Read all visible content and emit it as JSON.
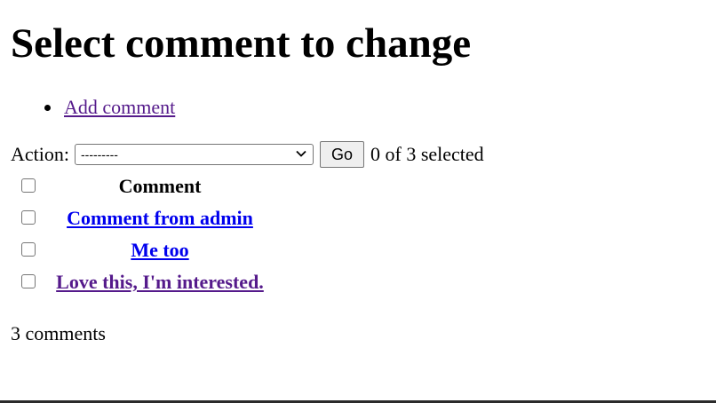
{
  "page": {
    "title": "Select comment to change"
  },
  "object_tools": {
    "add_label": "Add comment"
  },
  "actions": {
    "label": "Action:",
    "selected_option": "---------",
    "go_label": "Go",
    "selection_counter": "0 of 3 selected"
  },
  "table": {
    "header": "Comment",
    "rows": [
      {
        "label": "Comment from admin",
        "visited": false
      },
      {
        "label": "Me too",
        "visited": false
      },
      {
        "label": "Love this, I'm interested.",
        "visited": true
      }
    ]
  },
  "footer": {
    "count": "3 comments"
  },
  "colors": {
    "link_unvisited": "#0000ee",
    "link_visited": "#551a8b"
  }
}
